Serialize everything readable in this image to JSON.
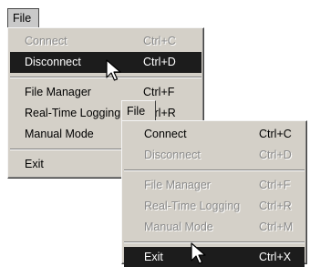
{
  "menubar": {
    "file_label": "File"
  },
  "menu_main": {
    "items": [
      {
        "label": "Connect",
        "shortcut": "Ctrl+C",
        "state": "disabled"
      },
      {
        "label": "Disconnect",
        "shortcut": "Ctrl+D",
        "state": "selected"
      },
      {
        "label": "File Manager",
        "shortcut": "Ctrl+F",
        "state": "enabled"
      },
      {
        "label": "Real-Time Logging",
        "shortcut": "Ctrl+R",
        "state": "enabled"
      },
      {
        "label": "Manual Mode",
        "shortcut": "",
        "state": "enabled"
      },
      {
        "label": "Exit",
        "shortcut": "",
        "state": "enabled"
      }
    ]
  },
  "menu_overlay": {
    "tab_label": "File",
    "items": [
      {
        "label": "Connect",
        "shortcut": "Ctrl+C",
        "state": "enabled"
      },
      {
        "label": "Disconnect",
        "shortcut": "Ctrl+D",
        "state": "disabled"
      },
      {
        "label": "File Manager",
        "shortcut": "Ctrl+F",
        "state": "disabled"
      },
      {
        "label": "Real-Time Logging",
        "shortcut": "Ctrl+R",
        "state": "disabled"
      },
      {
        "label": "Manual Mode",
        "shortcut": "Ctrl+M",
        "state": "disabled"
      },
      {
        "label": "Exit",
        "shortcut": "Ctrl+X",
        "state": "selected"
      }
    ]
  },
  "colors": {
    "menu_bg": "#d4d0c8",
    "highlight_bg": "#1c1c1c",
    "disabled_text": "#8a8a8a"
  },
  "cursor_icon": "arrow-pointer-icon"
}
